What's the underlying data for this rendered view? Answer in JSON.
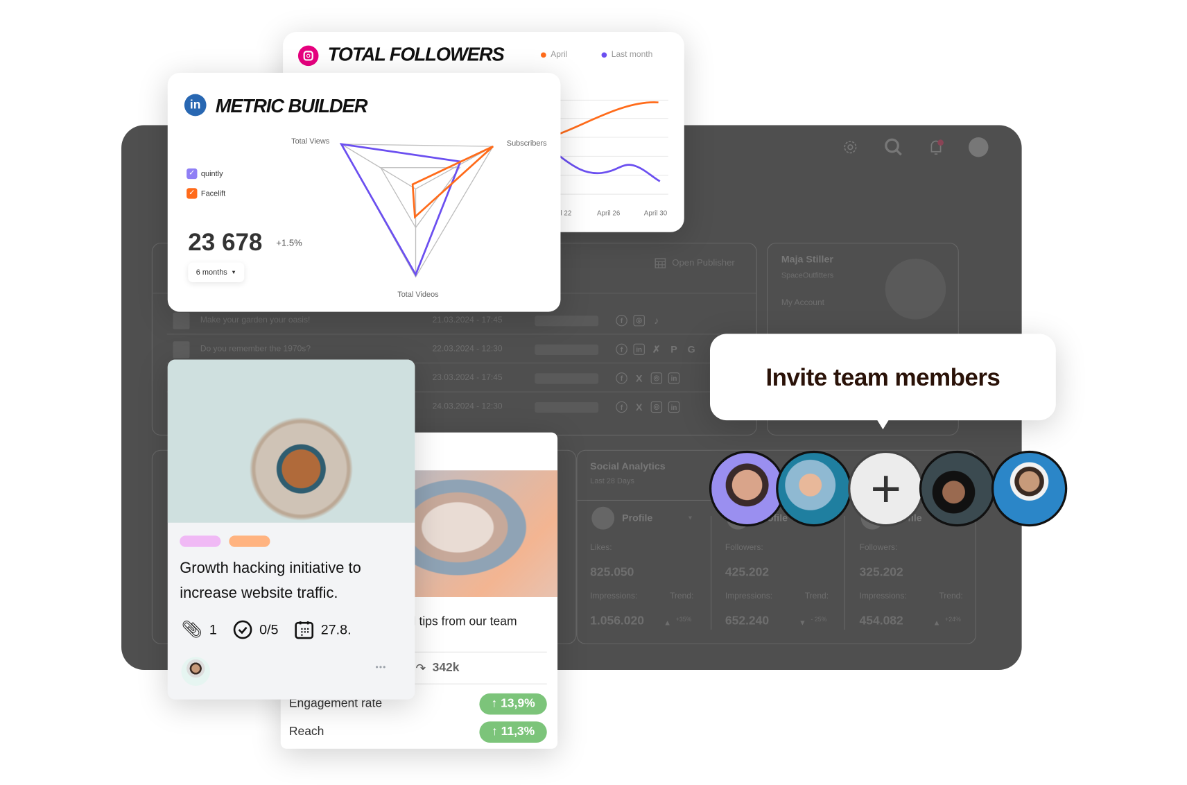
{
  "dashboard": {
    "header_icons": [
      "gear-icon",
      "search-icon",
      "bell-icon",
      "avatar"
    ],
    "publisher": {
      "open_publisher": "Open Publisher",
      "rows": [
        {
          "title": "Make your garden your oasis!",
          "date": "21.03.2024 - 17:45",
          "networks": [
            "facebook",
            "instagram",
            "tiktok"
          ]
        },
        {
          "title": "Do you remember the 1970s?",
          "date": "22.03.2024 - 12:30",
          "networks": [
            "facebook",
            "linkedin",
            "xing",
            "pinterest",
            "google"
          ]
        },
        {
          "title": "",
          "date": "23.03.2024 - 17:45",
          "networks": [
            "facebook",
            "x",
            "instagram",
            "linkedin"
          ]
        },
        {
          "title": "",
          "date": "24.03.2024 - 12:30",
          "networks": [
            "facebook",
            "x",
            "instagram",
            "linkedin"
          ]
        }
      ]
    },
    "account": {
      "name": "Maja Stiller",
      "company": "SpaceOutfitters",
      "link": "My Account"
    },
    "social_analytics": {
      "title": "Social Analytics",
      "subtitle": "Last 28 Days",
      "columns": [
        {
          "profile": "Profile",
          "metric_label": "Likes:",
          "metric_value": "825.050",
          "impressions_label": "Impressions:",
          "impressions_value": "1.056.020",
          "trend_label": "Trend:",
          "trend": "+35%",
          "trend_dir": "up"
        },
        {
          "profile": "Profile",
          "metric_label": "Followers:",
          "metric_value": "425.202",
          "impressions_label": "Impressions:",
          "impressions_value": "652.240",
          "trend_label": "Trend:",
          "trend": "- 25%",
          "trend_dir": "down"
        },
        {
          "profile": "Profile",
          "metric_label": "Followers:",
          "metric_value": "325.202",
          "impressions_label": "Impressions:",
          "impressions_value": "454.082",
          "trend_label": "Trend:",
          "trend": "+24%",
          "trend_dir": "up"
        }
      ]
    }
  },
  "followers_card": {
    "title": "TOTAL FOLLOWERS",
    "icon": "instagram-icon",
    "legend": [
      {
        "label": "April",
        "color": "#ff6b1a"
      },
      {
        "label": "Last month",
        "color": "#6b4ff0"
      }
    ],
    "x_ticks": [
      "l 22",
      "April 26",
      "April 30"
    ]
  },
  "metric_card": {
    "title": "METRIC BUILDER",
    "icon": "linkedin-icon",
    "legend": [
      {
        "label": "quintly",
        "color": "#8f7ff5",
        "checked": true
      },
      {
        "label": "Facelift",
        "color": "#ff6a1a",
        "checked": true
      }
    ],
    "value": "23 678",
    "change": "+1.5%",
    "period": "6 months",
    "axes": [
      "Total Views",
      "Subscribers",
      "Total Videos"
    ]
  },
  "chart_data": [
    {
      "type": "line",
      "title": "TOTAL FOLLOWERS",
      "x_ticks": [
        "April 22",
        "April 26",
        "April 30"
      ],
      "series": [
        {
          "name": "April",
          "color": "#ff6b1a",
          "trend": "rising"
        },
        {
          "name": "Last month",
          "color": "#6b4ff0",
          "trend": "falling"
        }
      ],
      "grid": true,
      "legend": "top-right"
    },
    {
      "type": "radar",
      "title": "METRIC BUILDER",
      "axes": [
        "Total Views",
        "Subscribers",
        "Total Videos"
      ],
      "series": [
        {
          "name": "quintly",
          "color": "#6b4ff0"
        },
        {
          "name": "Facelift",
          "color": "#ff6b1a"
        }
      ]
    }
  ],
  "invite": {
    "label": "Invite team members",
    "add": "+"
  },
  "task_card": {
    "tags": [
      "#f0b9f5",
      "#ffb380"
    ],
    "title": "Growth hacking initiative to increase website traffic.",
    "attachments": "1",
    "checklist": "0/5",
    "due": "27.8.",
    "more": "•••"
  },
  "post_card": {
    "text": "il tips from our team",
    "shares": "342k",
    "metrics": [
      {
        "label": "Engagement rate",
        "value": "13,9%"
      },
      {
        "label": "Reach",
        "value": "11,3%"
      }
    ]
  }
}
